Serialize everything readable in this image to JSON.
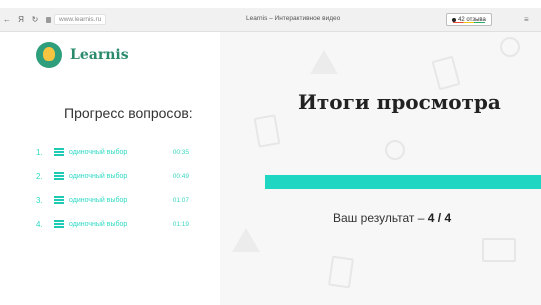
{
  "browser": {
    "url": "www.learnis.ru",
    "tab_title": "Learnis – Интерактивное видео",
    "reviews": "42 отзыва",
    "back": "←",
    "yandex": "Я",
    "reload": "↻",
    "bookmark": "≡"
  },
  "sidebar": {
    "brand": "Learnis",
    "progress_title": "Прогресс вопросов:",
    "items": [
      {
        "num": "1.",
        "label": "одиночный выбор",
        "time": "00:35"
      },
      {
        "num": "2.",
        "label": "одиночный выбор",
        "time": "00:49"
      },
      {
        "num": "3.",
        "label": "одиночный выбор",
        "time": "01:07"
      },
      {
        "num": "4.",
        "label": "одиночный выбор",
        "time": "01:19"
      }
    ]
  },
  "main": {
    "title": "Итоги просмотра",
    "score_label": "Ваш результат –",
    "score_value": "4 / 4",
    "accent": "#1ed6c2"
  }
}
